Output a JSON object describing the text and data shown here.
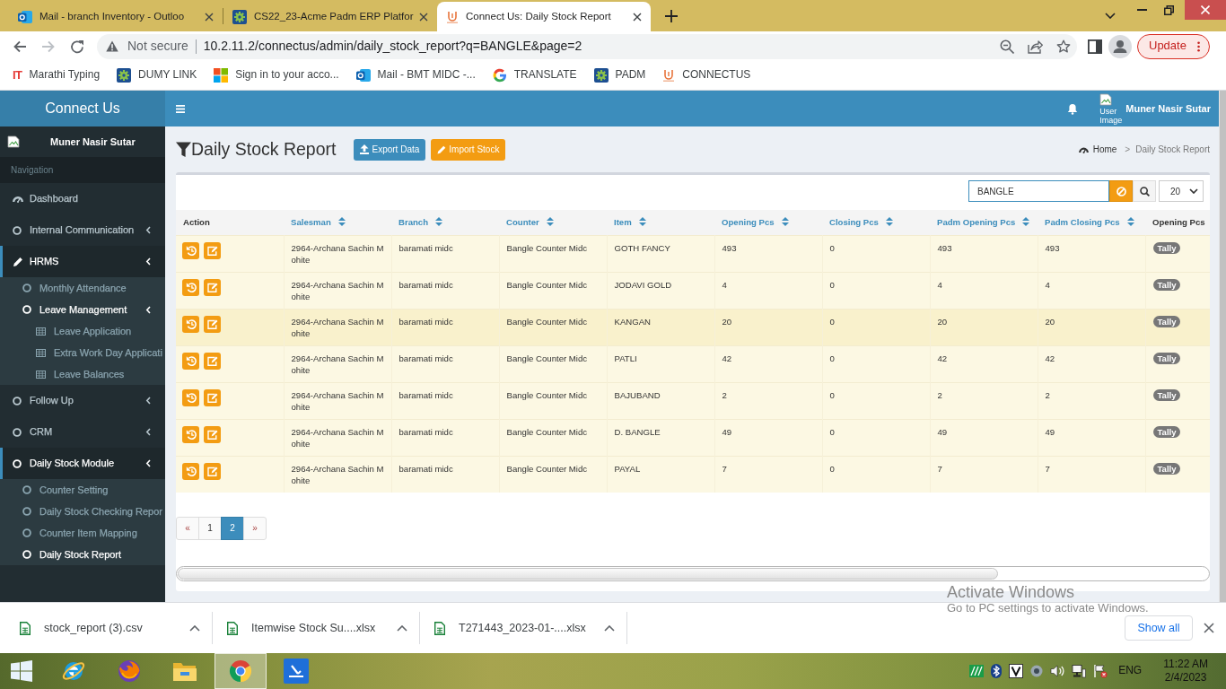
{
  "browser": {
    "tabs": [
      {
        "title": "Mail - branch Inventory - Outloo",
        "kind": "ring",
        "selected": false
      },
      {
        "title": "CS22_23-Acme Padm ERP Platfor",
        "kind": "gear",
        "selected": false
      },
      {
        "title": "Connect Us: Daily Stock Report",
        "kind": "logo",
        "selected": true
      }
    ],
    "toolbar": {
      "forward_disabled": true,
      "security": "Not secure",
      "url": "10.2.11.2/connectus/admin/daily_stock_report?q=BANGLE&page=2",
      "update": "Update"
    },
    "bookmarks": [
      {
        "label": "Marathi Typing",
        "kind": "letters",
        "icon_text": "IT"
      },
      {
        "label": "DUMY LINK",
        "kind": "gear"
      },
      {
        "label": "Sign in to your acco...",
        "kind": "squares"
      },
      {
        "label": "Mail - BMT MIDC -...",
        "kind": "ring"
      },
      {
        "label": "TRANSLATE",
        "kind": "g"
      },
      {
        "label": "PADM",
        "kind": "gear"
      },
      {
        "label": "CONNECTUS",
        "kind": "logo"
      }
    ]
  },
  "header": {
    "brand": "Connect Us",
    "user_image_alt": "User Image",
    "user_name": "Muner Nasir Sutar"
  },
  "sidebar": {
    "user_name": "Muner Nasir Sutar",
    "heading": "Navigation",
    "items": [
      {
        "label": "Dashboard",
        "kind": "dashboard",
        "selected": false,
        "has_submenu": false
      },
      {
        "label": "Internal Communication",
        "kind": "circle",
        "selected": false,
        "has_submenu": true
      },
      {
        "label": "HRMS",
        "kind": "pencil",
        "selected": true,
        "has_submenu": true,
        "children": [
          {
            "label": "Monthly Attendance",
            "kind": "circle",
            "selected": false,
            "has_submenu": false
          },
          {
            "label": "Leave Management",
            "kind": "circle",
            "selected": true,
            "has_submenu": true,
            "children": [
              {
                "label": "Leave Application",
                "kind": "table",
                "selected": false,
                "has_submenu": false
              },
              {
                "label": "Extra Work Day Applicati",
                "kind": "table",
                "selected": false,
                "has_submenu": false
              },
              {
                "label": "Leave Balances",
                "kind": "table",
                "selected": false,
                "has_submenu": false
              }
            ]
          }
        ]
      },
      {
        "label": "Follow Up",
        "kind": "circle",
        "selected": false,
        "has_submenu": true
      },
      {
        "label": "CRM",
        "kind": "circle",
        "selected": false,
        "has_submenu": true
      },
      {
        "label": "Daily Stock Module",
        "kind": "circle",
        "selected": true,
        "has_submenu": true,
        "children": [
          {
            "label": "Counter Setting",
            "kind": "circle",
            "selected": false,
            "has_submenu": false
          },
          {
            "label": "Daily Stock Checking Repor",
            "kind": "circle",
            "selected": false,
            "has_submenu": false
          },
          {
            "label": "Counter Item Mapping",
            "kind": "circle",
            "selected": false,
            "has_submenu": false
          },
          {
            "label": "Daily Stock Report",
            "kind": "circle",
            "selected": true,
            "has_submenu": false
          }
        ]
      }
    ]
  },
  "content": {
    "title": "Daily Stock Report",
    "actions": [
      {
        "label": "Export Data",
        "kind": "export"
      },
      {
        "label": "Import Stock",
        "kind": "import"
      }
    ],
    "breadcrumb": [
      {
        "label": "Home",
        "kind": "home"
      },
      {
        "label": "Daily Stock Report",
        "kind": "current"
      }
    ],
    "breadcrumb_separator": ">",
    "search": {
      "value": "BANGLE"
    },
    "page_size": "20",
    "table": {
      "columns": [
        {
          "label": "Action",
          "kind": "actions",
          "sortable": false
        },
        {
          "label": "Salesman",
          "kind": "text",
          "sortable": true
        },
        {
          "label": "Branch",
          "kind": "text",
          "sortable": true
        },
        {
          "label": "Counter",
          "kind": "text",
          "sortable": true
        },
        {
          "label": "Item",
          "kind": "text",
          "sortable": true
        },
        {
          "label": "Opening Pcs",
          "kind": "text",
          "sortable": true
        },
        {
          "label": "Closing Pcs",
          "kind": "text",
          "sortable": true
        },
        {
          "label": "Padm Opening Pcs",
          "kind": "text",
          "sortable": true
        },
        {
          "label": "Padm Closing Pcs",
          "kind": "text",
          "sortable": true
        },
        {
          "label": "Opening Pcs",
          "kind": "status",
          "sortable": false
        }
      ],
      "rows": [
        {
          "highlighted": false,
          "cells": [
            "",
            "2964-Archana Sachin Mohite",
            "baramati midc",
            "Bangle Counter Midc",
            "GOTH FANCY",
            "493",
            "0",
            "493",
            "493",
            "Tally"
          ]
        },
        {
          "highlighted": false,
          "cells": [
            "",
            "2964-Archana Sachin Mohite",
            "baramati midc",
            "Bangle Counter Midc",
            "JODAVI GOLD",
            "4",
            "0",
            "4",
            "4",
            "Tally"
          ]
        },
        {
          "highlighted": true,
          "cells": [
            "",
            "2964-Archana Sachin Mohite",
            "baramati midc",
            "Bangle Counter Midc",
            "KANGAN",
            "20",
            "0",
            "20",
            "20",
            "Tally"
          ]
        },
        {
          "highlighted": false,
          "cells": [
            "",
            "2964-Archana Sachin Mohite",
            "baramati midc",
            "Bangle Counter Midc",
            "PATLI",
            "42",
            "0",
            "42",
            "42",
            "Tally"
          ]
        },
        {
          "highlighted": false,
          "cells": [
            "",
            "2964-Archana Sachin Mohite",
            "baramati midc",
            "Bangle Counter Midc",
            "BAJUBAND",
            "2",
            "0",
            "2",
            "2",
            "Tally"
          ]
        },
        {
          "highlighted": false,
          "cells": [
            "",
            "2964-Archana Sachin Mohite",
            "baramati midc",
            "Bangle Counter Midc",
            "D. BANGLE",
            "49",
            "0",
            "49",
            "49",
            "Tally"
          ]
        },
        {
          "highlighted": false,
          "cells": [
            "",
            "2964-Archana Sachin Mohite",
            "baramati midc",
            "Bangle Counter Midc",
            "PAYAL",
            "7",
            "0",
            "7",
            "7",
            "Tally"
          ]
        }
      ]
    },
    "pagination": [
      {
        "label": "«",
        "kind": "prev",
        "selected": false
      },
      {
        "label": "1",
        "kind": "page",
        "selected": false
      },
      {
        "label": "2",
        "kind": "page",
        "selected": true
      },
      {
        "label": "»",
        "kind": "next",
        "selected": false
      }
    ]
  },
  "downloads": {
    "items": [
      {
        "name": "stock_report (3).csv"
      },
      {
        "name": "Itemwise Stock Su....xlsx"
      },
      {
        "name": "T271443_2023-01-....xlsx"
      }
    ],
    "show_all": "Show all"
  },
  "activation_notice": {
    "title": "Activate Windows",
    "text": "Go to PC settings to activate Windows."
  },
  "taskbar": {
    "apps": [
      {
        "kind": "ie",
        "selected": false
      },
      {
        "kind": "firefox",
        "selected": false
      },
      {
        "kind": "explorer",
        "selected": false
      },
      {
        "kind": "chrome",
        "selected": true
      },
      {
        "kind": "scanner",
        "selected": false
      }
    ],
    "language": "ENG",
    "time": "11:22 AM",
    "date": "2/4/2023"
  }
}
